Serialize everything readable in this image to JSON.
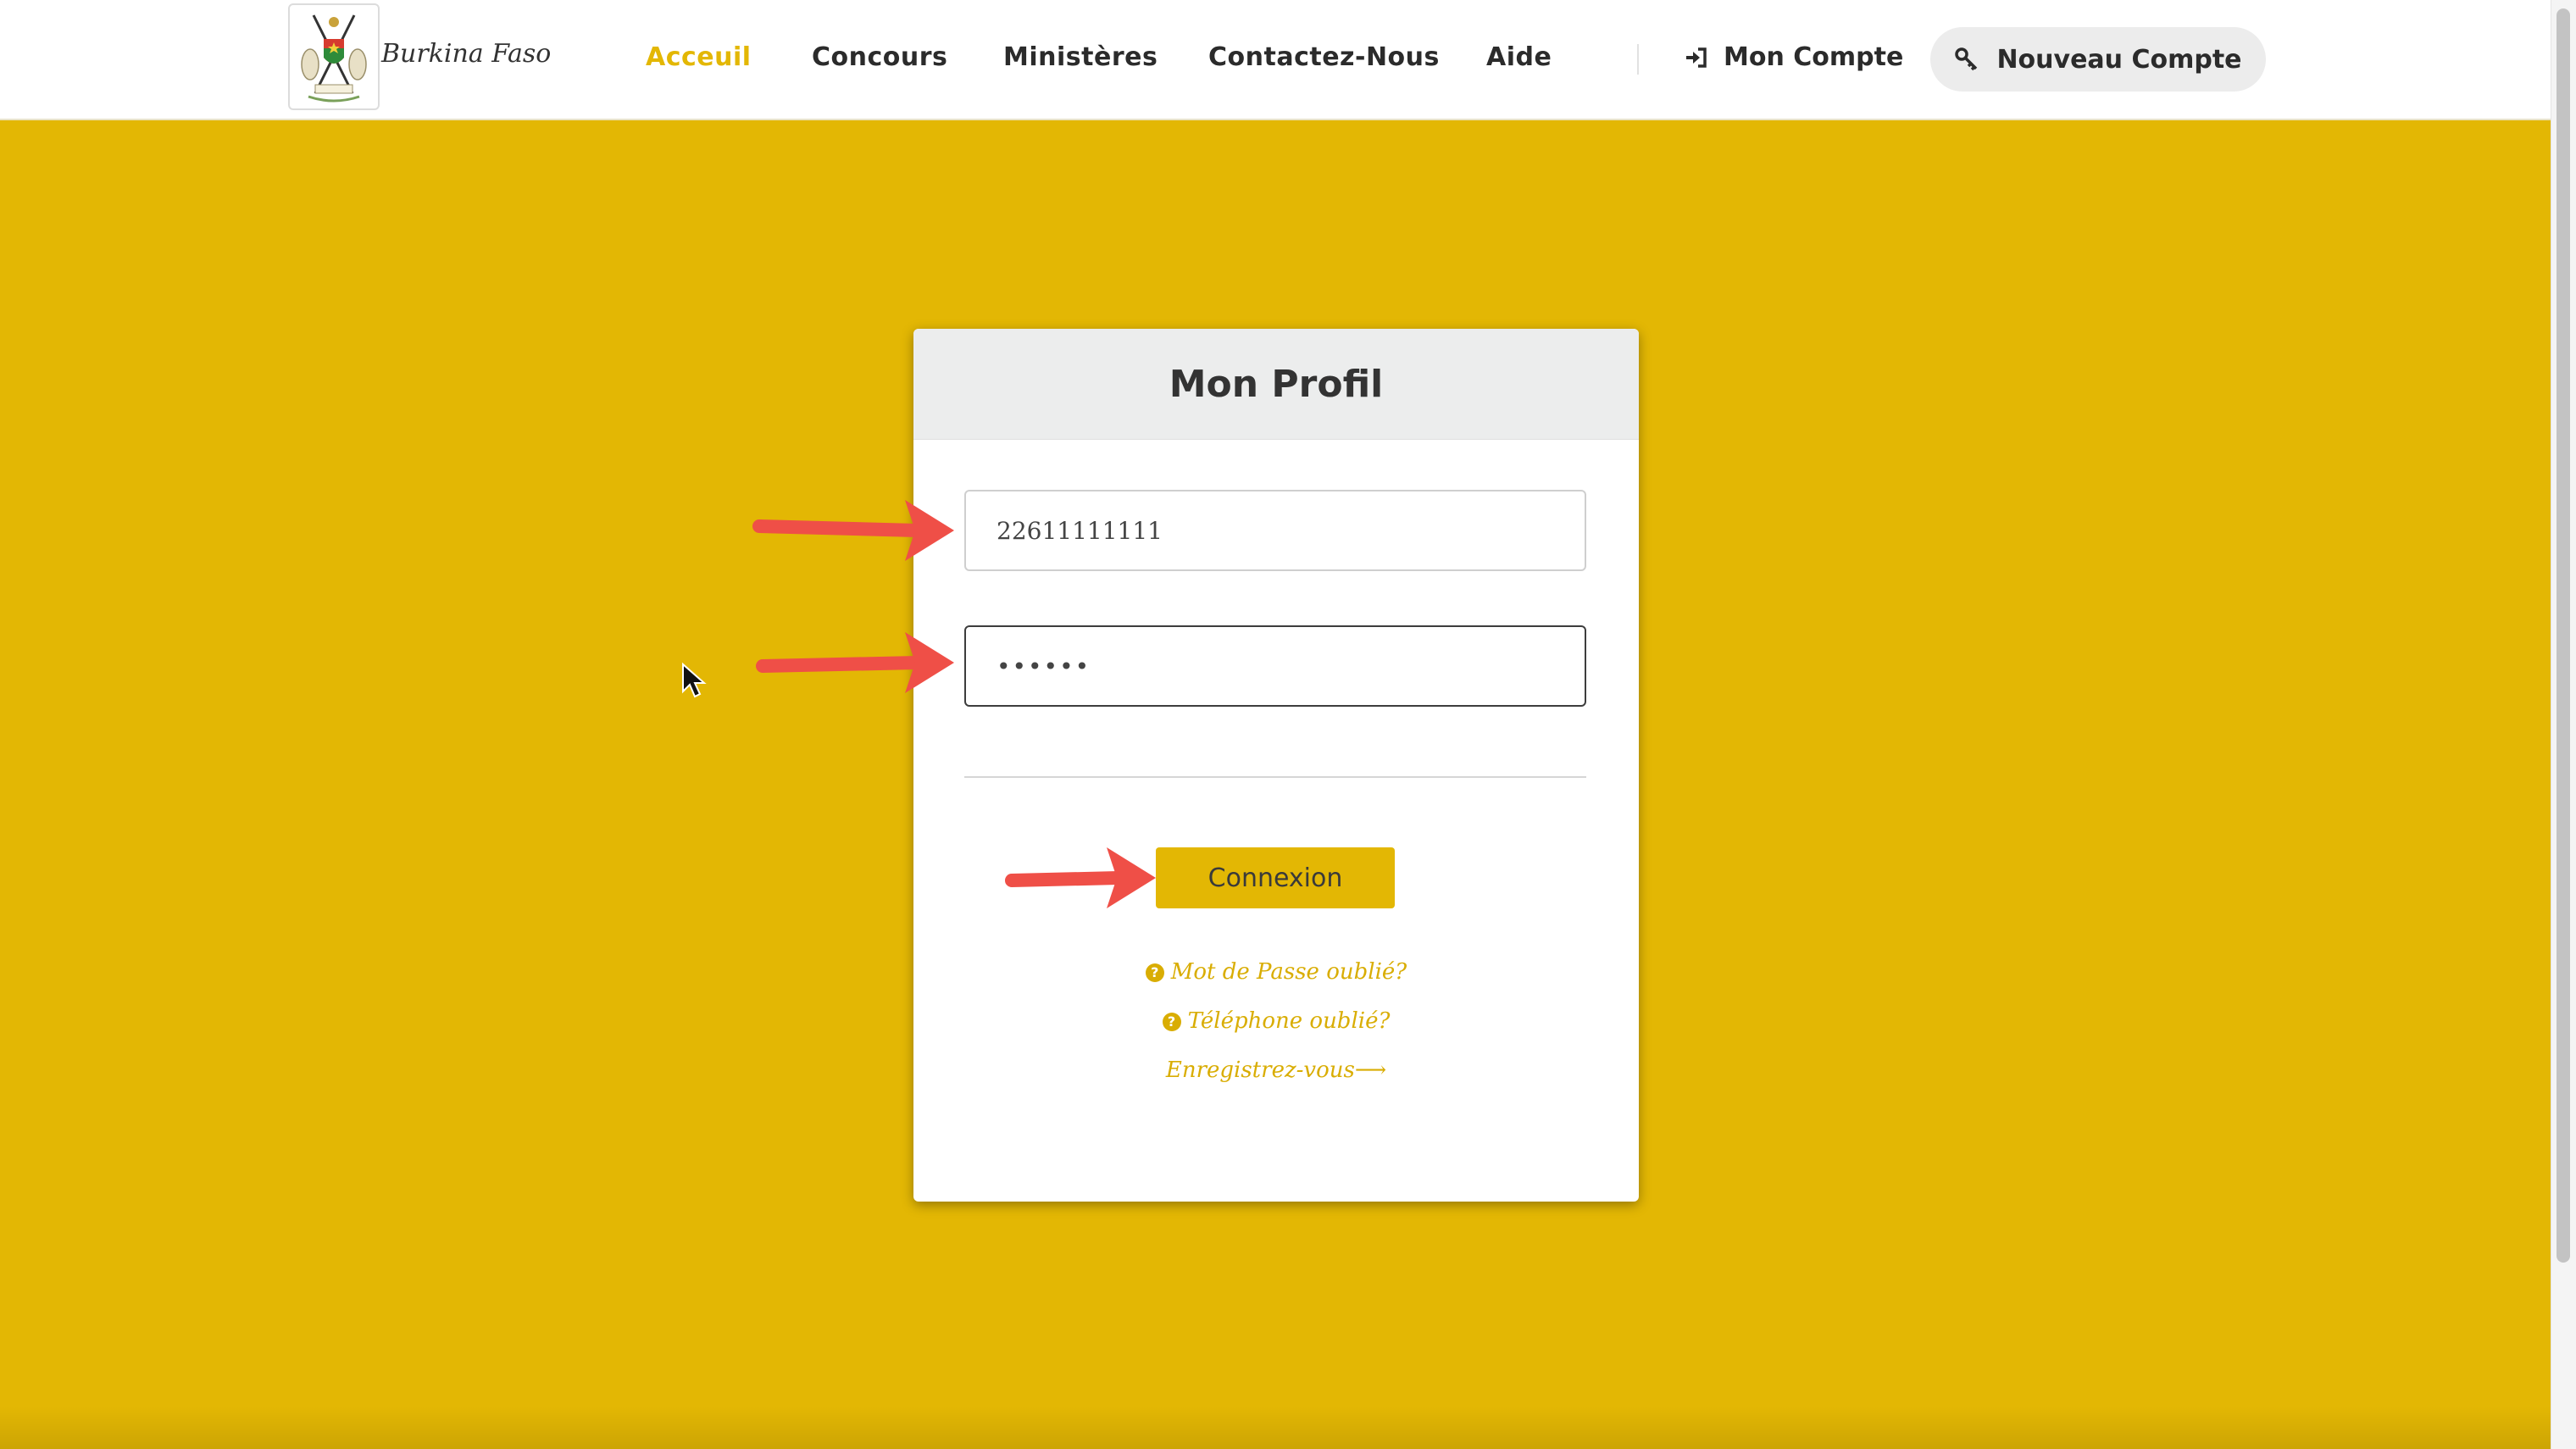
{
  "header": {
    "brand": "Burkina Faso",
    "nav": [
      {
        "label": "Acceuil",
        "active": true
      },
      {
        "label": "Concours",
        "active": false
      },
      {
        "label": "Ministères",
        "active": false
      },
      {
        "label": "Contactez-Nous",
        "active": false
      },
      {
        "label": "Aide",
        "active": false
      }
    ],
    "account_label": "Mon Compte",
    "new_account_label": "Nouveau Compte"
  },
  "login": {
    "title": "Mon Profil",
    "phone_value": "22611111111",
    "password_value": "••••••",
    "submit_label": "Connexion",
    "forgot_password": "Mot de Passe oublié?",
    "forgot_phone": "Téléphone oublié?",
    "register": "Enregistrez-vous⟶"
  },
  "colors": {
    "accent": "#e3b704",
    "annotation_arrow": "#ef4f47"
  },
  "icons": {
    "account": "sign-in-icon",
    "new_account": "key-icon",
    "help": "question-circle-icon"
  }
}
